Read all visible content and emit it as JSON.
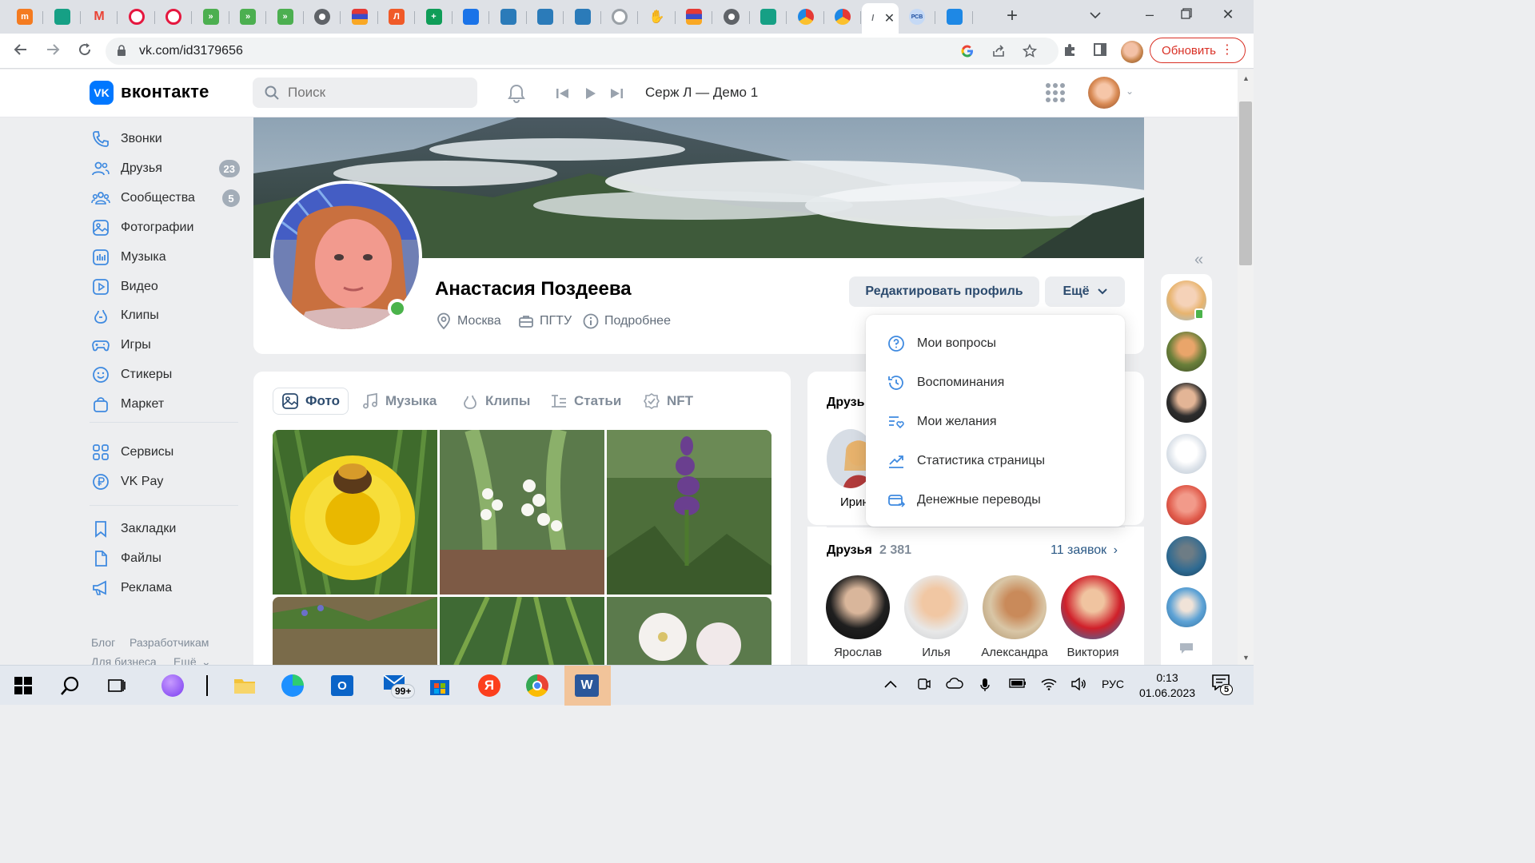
{
  "browser": {
    "tabs": [
      {
        "icon": "tm-icon",
        "glyph": "m",
        "color": "#f47b20"
      },
      {
        "icon": "frog-icon",
        "glyph": "",
        "color": "#16a085"
      },
      {
        "icon": "gmail-icon",
        "glyph": "M",
        "color": "#ea4335"
      },
      {
        "icon": "ring-icon",
        "glyph": "",
        "color": "#e5173f"
      },
      {
        "icon": "ring-icon",
        "glyph": "",
        "color": "#e5173f"
      },
      {
        "icon": "forward-icon",
        "glyph": "»",
        "color": "#4caf50"
      },
      {
        "icon": "forward-icon",
        "glyph": "»",
        "color": "#4caf50"
      },
      {
        "icon": "forward-icon",
        "glyph": "»",
        "color": "#4caf50"
      },
      {
        "icon": "globe-icon",
        "glyph": "",
        "color": "#5f6368"
      },
      {
        "icon": "stripes-icon",
        "glyph": "",
        "color": "#3b4cca"
      },
      {
        "icon": "l-icon",
        "glyph": "Л",
        "color": "#f05a28"
      },
      {
        "icon": "plus-sheet-icon",
        "glyph": "+",
        "color": "#0f9d58"
      },
      {
        "icon": "bird-icon",
        "glyph": "",
        "color": "#1a73e8"
      },
      {
        "icon": "person-icon",
        "glyph": "",
        "color": "#2b7bb9"
      },
      {
        "icon": "person-icon",
        "glyph": "",
        "color": "#2b7bb9"
      },
      {
        "icon": "person-icon",
        "glyph": "",
        "color": "#2b7bb9"
      },
      {
        "icon": "ring-gray-icon",
        "glyph": "",
        "color": "#9aa0a6"
      },
      {
        "icon": "hand-icon",
        "glyph": "",
        "color": "#e8a04b"
      },
      {
        "icon": "stripes-icon",
        "glyph": "",
        "color": "#3b4cca"
      },
      {
        "icon": "chrome-gray-icon",
        "glyph": "",
        "color": "#5f6368"
      },
      {
        "icon": "frog-icon",
        "glyph": "",
        "color": "#16a085"
      },
      {
        "icon": "ria-icon",
        "glyph": "",
        "color": "#e53935"
      },
      {
        "icon": "ria-icon",
        "glyph": "",
        "color": "#e53935"
      },
      {
        "icon": "vk-tab-icon",
        "glyph": "",
        "color": "#0077ff",
        "active": true
      },
      {
        "icon": "pcb-icon",
        "glyph": "РСВ",
        "color": "#4a90e2"
      },
      {
        "icon": "swoosh-icon",
        "glyph": "",
        "color": "#1e88e5"
      }
    ],
    "url": "vk.com/id3179656",
    "update_label": "Обновить"
  },
  "header": {
    "brand": "вконтакте",
    "search_placeholder": "Поиск",
    "now_playing": "Серж Л — Демо 1"
  },
  "sidebar": {
    "items": [
      {
        "label": "Звонки",
        "icon": "phone-icon"
      },
      {
        "label": "Друзья",
        "icon": "friends-icon",
        "badge": "23"
      },
      {
        "label": "Сообщества",
        "icon": "communities-icon",
        "badge": "5"
      },
      {
        "label": "Фотографии",
        "icon": "photos-icon"
      },
      {
        "label": "Музыка",
        "icon": "music-icon"
      },
      {
        "label": "Видео",
        "icon": "video-icon"
      },
      {
        "label": "Клипы",
        "icon": "clips-icon"
      },
      {
        "label": "Игры",
        "icon": "games-icon"
      },
      {
        "label": "Стикеры",
        "icon": "stickers-icon"
      },
      {
        "label": "Маркет",
        "icon": "market-icon"
      },
      {
        "label": "Сервисы",
        "icon": "services-icon"
      },
      {
        "label": "VK Pay",
        "icon": "vkpay-icon"
      },
      {
        "label": "Закладки",
        "icon": "bookmarks-icon"
      },
      {
        "label": "Файлы",
        "icon": "files-icon"
      },
      {
        "label": "Реклама",
        "icon": "ads-icon"
      }
    ],
    "footer": {
      "blog": "Блог",
      "developers": "Разработчикам",
      "business": "Для бизнеса",
      "more": "Ещё"
    }
  },
  "profile": {
    "name": "Анастасия Поздеева",
    "city": "Москва",
    "university": "ПГТУ",
    "details": "Подробнее",
    "edit_label": "Редактировать профиль",
    "more_label": "Ещё"
  },
  "dropdown": {
    "items": [
      {
        "label": "Мои вопросы",
        "icon": "question-icon"
      },
      {
        "label": "Воспоминания",
        "icon": "history-icon"
      },
      {
        "label": "Мои желания",
        "icon": "wishlist-icon"
      },
      {
        "label": "Статистика страницы",
        "icon": "stats-icon"
      },
      {
        "label": "Денежные переводы",
        "icon": "transfer-icon"
      }
    ]
  },
  "media_tabs": [
    {
      "label": "Фото",
      "icon": "photo-icon",
      "active": true
    },
    {
      "label": "Музыка",
      "icon": "music-note-icon"
    },
    {
      "label": "Клипы",
      "icon": "clips-icon"
    },
    {
      "label": "Статьи",
      "icon": "articles-icon"
    },
    {
      "label": "NFT",
      "icon": "nft-icon"
    }
  ],
  "right": {
    "top_title_partial": "Друзь",
    "top_friend_partial": "Ирин",
    "friends_title": "Друзья",
    "friends_count": "2 381",
    "requests_link": "11 заявок",
    "friends": [
      {
        "name": "Ярослав"
      },
      {
        "name": "Илья"
      },
      {
        "name": "Александра"
      },
      {
        "name": "Виктория"
      }
    ]
  },
  "taskbar": {
    "mail_badge": "99+",
    "language": "РУС",
    "time": "0:13",
    "date": "01.06.2023",
    "notifications": "5"
  }
}
